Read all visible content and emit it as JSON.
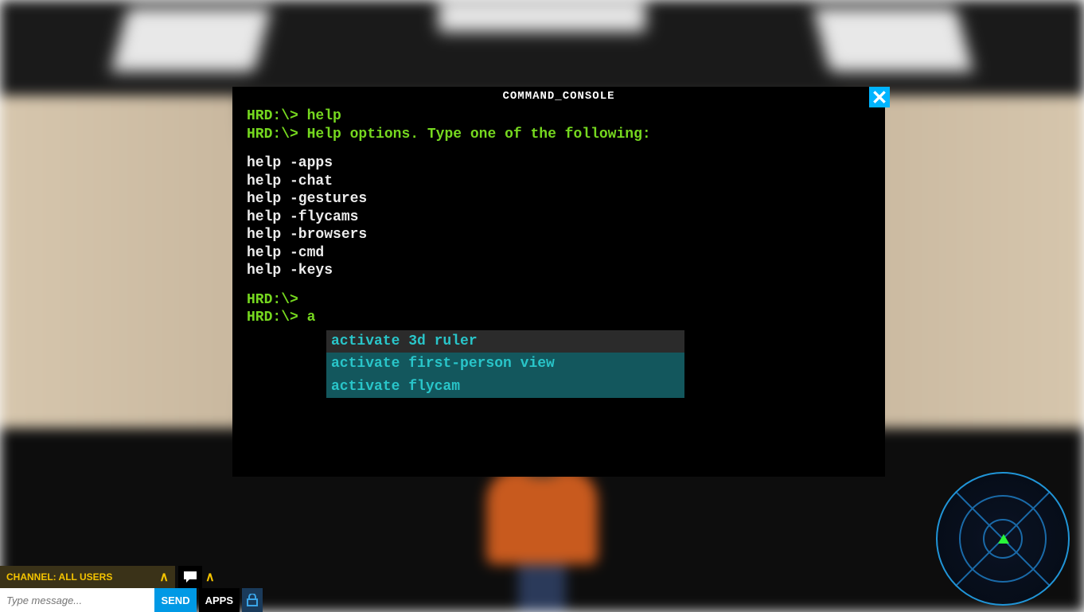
{
  "console": {
    "title": "COMMAND_CONSOLE",
    "prompt": "HRD:\\>",
    "lines": {
      "cmd1": "help",
      "resp1": "Help options. Type one of the following:",
      "help_items": [
        "help -apps",
        "help -chat",
        "help -gestures",
        "help -flycams",
        "help -browsers",
        "help -cmd",
        "help -keys"
      ],
      "blank_prompt": "",
      "current_input": "a"
    },
    "suggestions": [
      "activate 3d ruler",
      "activate first-person view",
      "activate flycam"
    ]
  },
  "hud": {
    "channel_label": "CHANNEL: ALL USERS",
    "message_placeholder": "Type message...",
    "send_label": "SEND",
    "apps_label": "APPS"
  },
  "icons": {
    "close": "close-icon",
    "chat": "chat-icon",
    "lock": "lock-icon",
    "chevron_up": "chevron-up-icon",
    "radar_marker": "player-marker-icon"
  },
  "colors": {
    "console_text": "#76d81f",
    "suggestion_text": "#29c5c9",
    "suggestion_highlight_bg": "#13575d",
    "accent_gold": "#f5c400",
    "accent_blue": "#0099e5",
    "close_bg": "#00b4ff"
  }
}
